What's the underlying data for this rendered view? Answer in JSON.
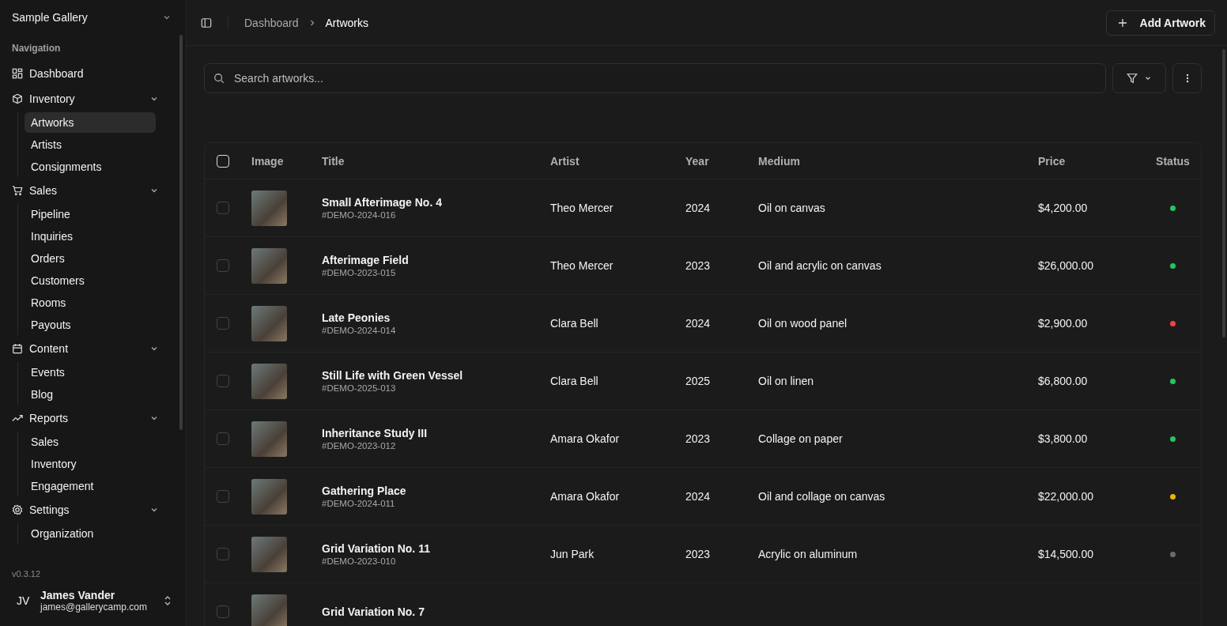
{
  "workspace": {
    "name": "Sample Gallery"
  },
  "sidebar": {
    "heading": "Navigation",
    "sections": [
      {
        "label": "Dashboard",
        "selected": false
      },
      {
        "label": "Inventory",
        "expanded": true,
        "selected": false,
        "children": [
          {
            "label": "Artworks",
            "selected": true
          },
          {
            "label": "Artists",
            "selected": false
          },
          {
            "label": "Consignments",
            "selected": false
          }
        ]
      },
      {
        "label": "Sales",
        "expanded": true,
        "selected": false,
        "children": [
          {
            "label": "Pipeline",
            "selected": false
          },
          {
            "label": "Inquiries",
            "selected": false
          },
          {
            "label": "Orders",
            "selected": false
          },
          {
            "label": "Customers",
            "selected": false
          },
          {
            "label": "Rooms",
            "selected": false
          },
          {
            "label": "Payouts",
            "selected": false
          }
        ]
      },
      {
        "label": "Content",
        "expanded": true,
        "selected": false,
        "children": [
          {
            "label": "Events",
            "selected": false
          },
          {
            "label": "Blog",
            "selected": false
          }
        ]
      },
      {
        "label": "Reports",
        "expanded": true,
        "selected": false,
        "children": [
          {
            "label": "Sales",
            "selected": false
          },
          {
            "label": "Inventory",
            "selected": false
          },
          {
            "label": "Engagement",
            "selected": false
          }
        ]
      },
      {
        "label": "Settings",
        "expanded": true,
        "selected": false,
        "children": [
          {
            "label": "Organization",
            "selected": false
          }
        ]
      }
    ],
    "version": "v0.3.12",
    "user": {
      "initials": "JV",
      "name": "James Vander",
      "email": "james@gallerycamp.com"
    }
  },
  "breadcrumb": [
    {
      "label": "Dashboard",
      "selected": false
    },
    {
      "label": "Artworks",
      "selected": true
    }
  ],
  "add_button": {
    "label": "Add Artwork"
  },
  "search": {
    "placeholder": "Search artworks..."
  },
  "table": {
    "select_all": {
      "checked": false
    },
    "columns": [
      "Image",
      "Title",
      "Artist",
      "Year",
      "Medium",
      "Price",
      "Status"
    ],
    "rows": [
      {
        "checked": false,
        "title": "Small Afterimage No. 4",
        "code": "#DEMO-2024-016",
        "artist": "Theo Mercer",
        "year": "2024",
        "medium": "Oil on canvas",
        "price": "$4,200.00",
        "color": "#22c55e"
      },
      {
        "checked": false,
        "title": "Afterimage Field",
        "code": "#DEMO-2023-015",
        "artist": "Theo Mercer",
        "year": "2023",
        "medium": "Oil and acrylic on canvas",
        "price": "$26,000.00",
        "color": "#22c55e"
      },
      {
        "checked": false,
        "title": "Late Peonies",
        "code": "#DEMO-2024-014",
        "artist": "Clara Bell",
        "year": "2024",
        "medium": "Oil on wood panel",
        "price": "$2,900.00",
        "color": "#ef4444"
      },
      {
        "checked": false,
        "title": "Still Life with Green Vessel",
        "code": "#DEMO-2025-013",
        "artist": "Clara Bell",
        "year": "2025",
        "medium": "Oil on linen",
        "price": "$6,800.00",
        "color": "#22c55e"
      },
      {
        "checked": false,
        "title": "Inheritance Study III",
        "code": "#DEMO-2023-012",
        "artist": "Amara Okafor",
        "year": "2023",
        "medium": "Collage on paper",
        "price": "$3,800.00",
        "color": "#22c55e"
      },
      {
        "checked": false,
        "title": "Gathering Place",
        "code": "#DEMO-2024-011",
        "artist": "Amara Okafor",
        "year": "2024",
        "medium": "Oil and collage on canvas",
        "price": "$22,000.00",
        "color": "#eab308"
      },
      {
        "checked": false,
        "title": "Grid Variation No. 11",
        "code": "#DEMO-2023-010",
        "artist": "Jun Park",
        "year": "2023",
        "medium": "Acrylic on aluminum",
        "price": "$14,500.00",
        "color": "#6b6b6b"
      },
      {
        "checked": false,
        "title": "Grid Variation No. 7"
      }
    ]
  }
}
